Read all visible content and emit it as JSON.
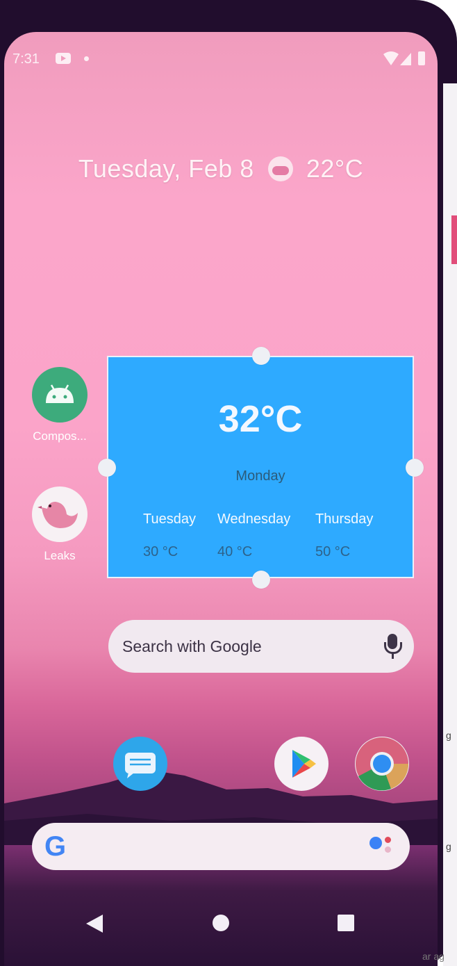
{
  "status_bar": {
    "time": "7:31"
  },
  "glance": {
    "date": "Tuesday, Feb 8",
    "temperature": "22°C"
  },
  "apps": [
    {
      "label": "Compos..."
    },
    {
      "label": "Leaks"
    }
  ],
  "weather_widget": {
    "current_temp": "32°C",
    "current_day": "Monday",
    "forecast": [
      {
        "day": "Tuesday",
        "temp": "30 °C"
      },
      {
        "day": "Wednesday",
        "temp": "40 °C"
      },
      {
        "day": "Thursday",
        "temp": "50 °C"
      }
    ],
    "background_color": "#2eaaff"
  },
  "search": {
    "placeholder": "Search with Google"
  },
  "dock": [
    "messages-icon",
    "play-store-icon",
    "chrome-icon"
  ],
  "google_bar": {
    "logo": "G"
  },
  "side_panel": {
    "text1": "g",
    "text2": "ar ag"
  }
}
